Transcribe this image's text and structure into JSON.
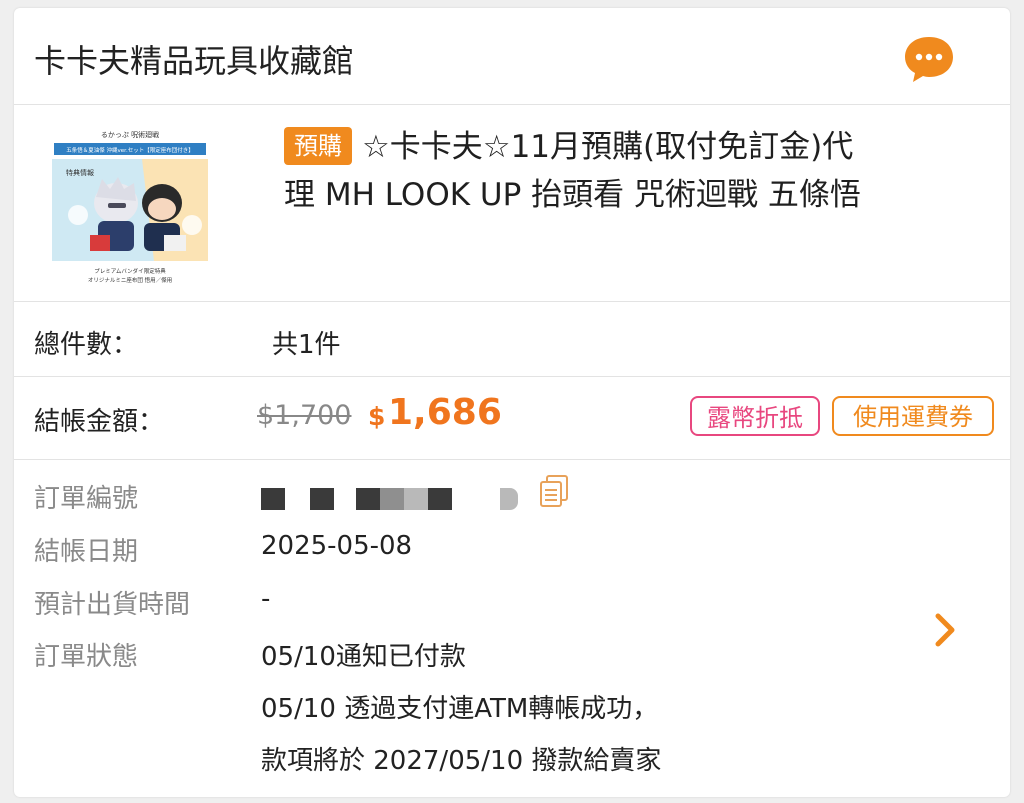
{
  "shop": {
    "name": "卡卡夫精品玩具收藏館",
    "chat_icon": "chat-bubble-icon",
    "accent": "#f08a1e"
  },
  "product": {
    "badge": "預購",
    "title_line1": "☆卡卡夫☆11月預購(取付免訂金)代",
    "title_line2": "理 MH LOOK UP 抬頭看 咒術迴戰 五條悟",
    "thumb": {
      "brand": "るかっぷ 呪術廻戦",
      "banner": "五条悟＆夏油傑 沖縄ver.セット【限定座布団付き】",
      "tag": "特典情報",
      "caption1": "プレミアムバンダイ限定特典",
      "caption2": "オリジナルミニ座布団 悟用／傑用"
    }
  },
  "summary": {
    "count_label": "總件數：",
    "count_value": "共1件",
    "amount_label": "結帳金額：",
    "old_price": "$1,700",
    "currency": "$",
    "price": "1,686",
    "coin_button": "露幣折抵",
    "shipping_button": "使用運費券"
  },
  "info": {
    "order_no_label": "訂單編號",
    "date_label": "結帳日期",
    "date_value": "2025-05-08",
    "ship_label": "預計出貨時間",
    "ship_value": "-",
    "status_label": "訂單狀態",
    "status_line1": "05/10通知已付款",
    "status_line2": "05/10 透過支付連ATM轉帳成功，",
    "status_line3": "款項將於 2027/05/10 撥款給賣家",
    "copy_icon": "copy-icon",
    "chevron_icon": "chevron-right-icon"
  },
  "colors": {
    "orange": "#f08a1e",
    "pink": "#e8477f",
    "price": "#f0751e"
  }
}
